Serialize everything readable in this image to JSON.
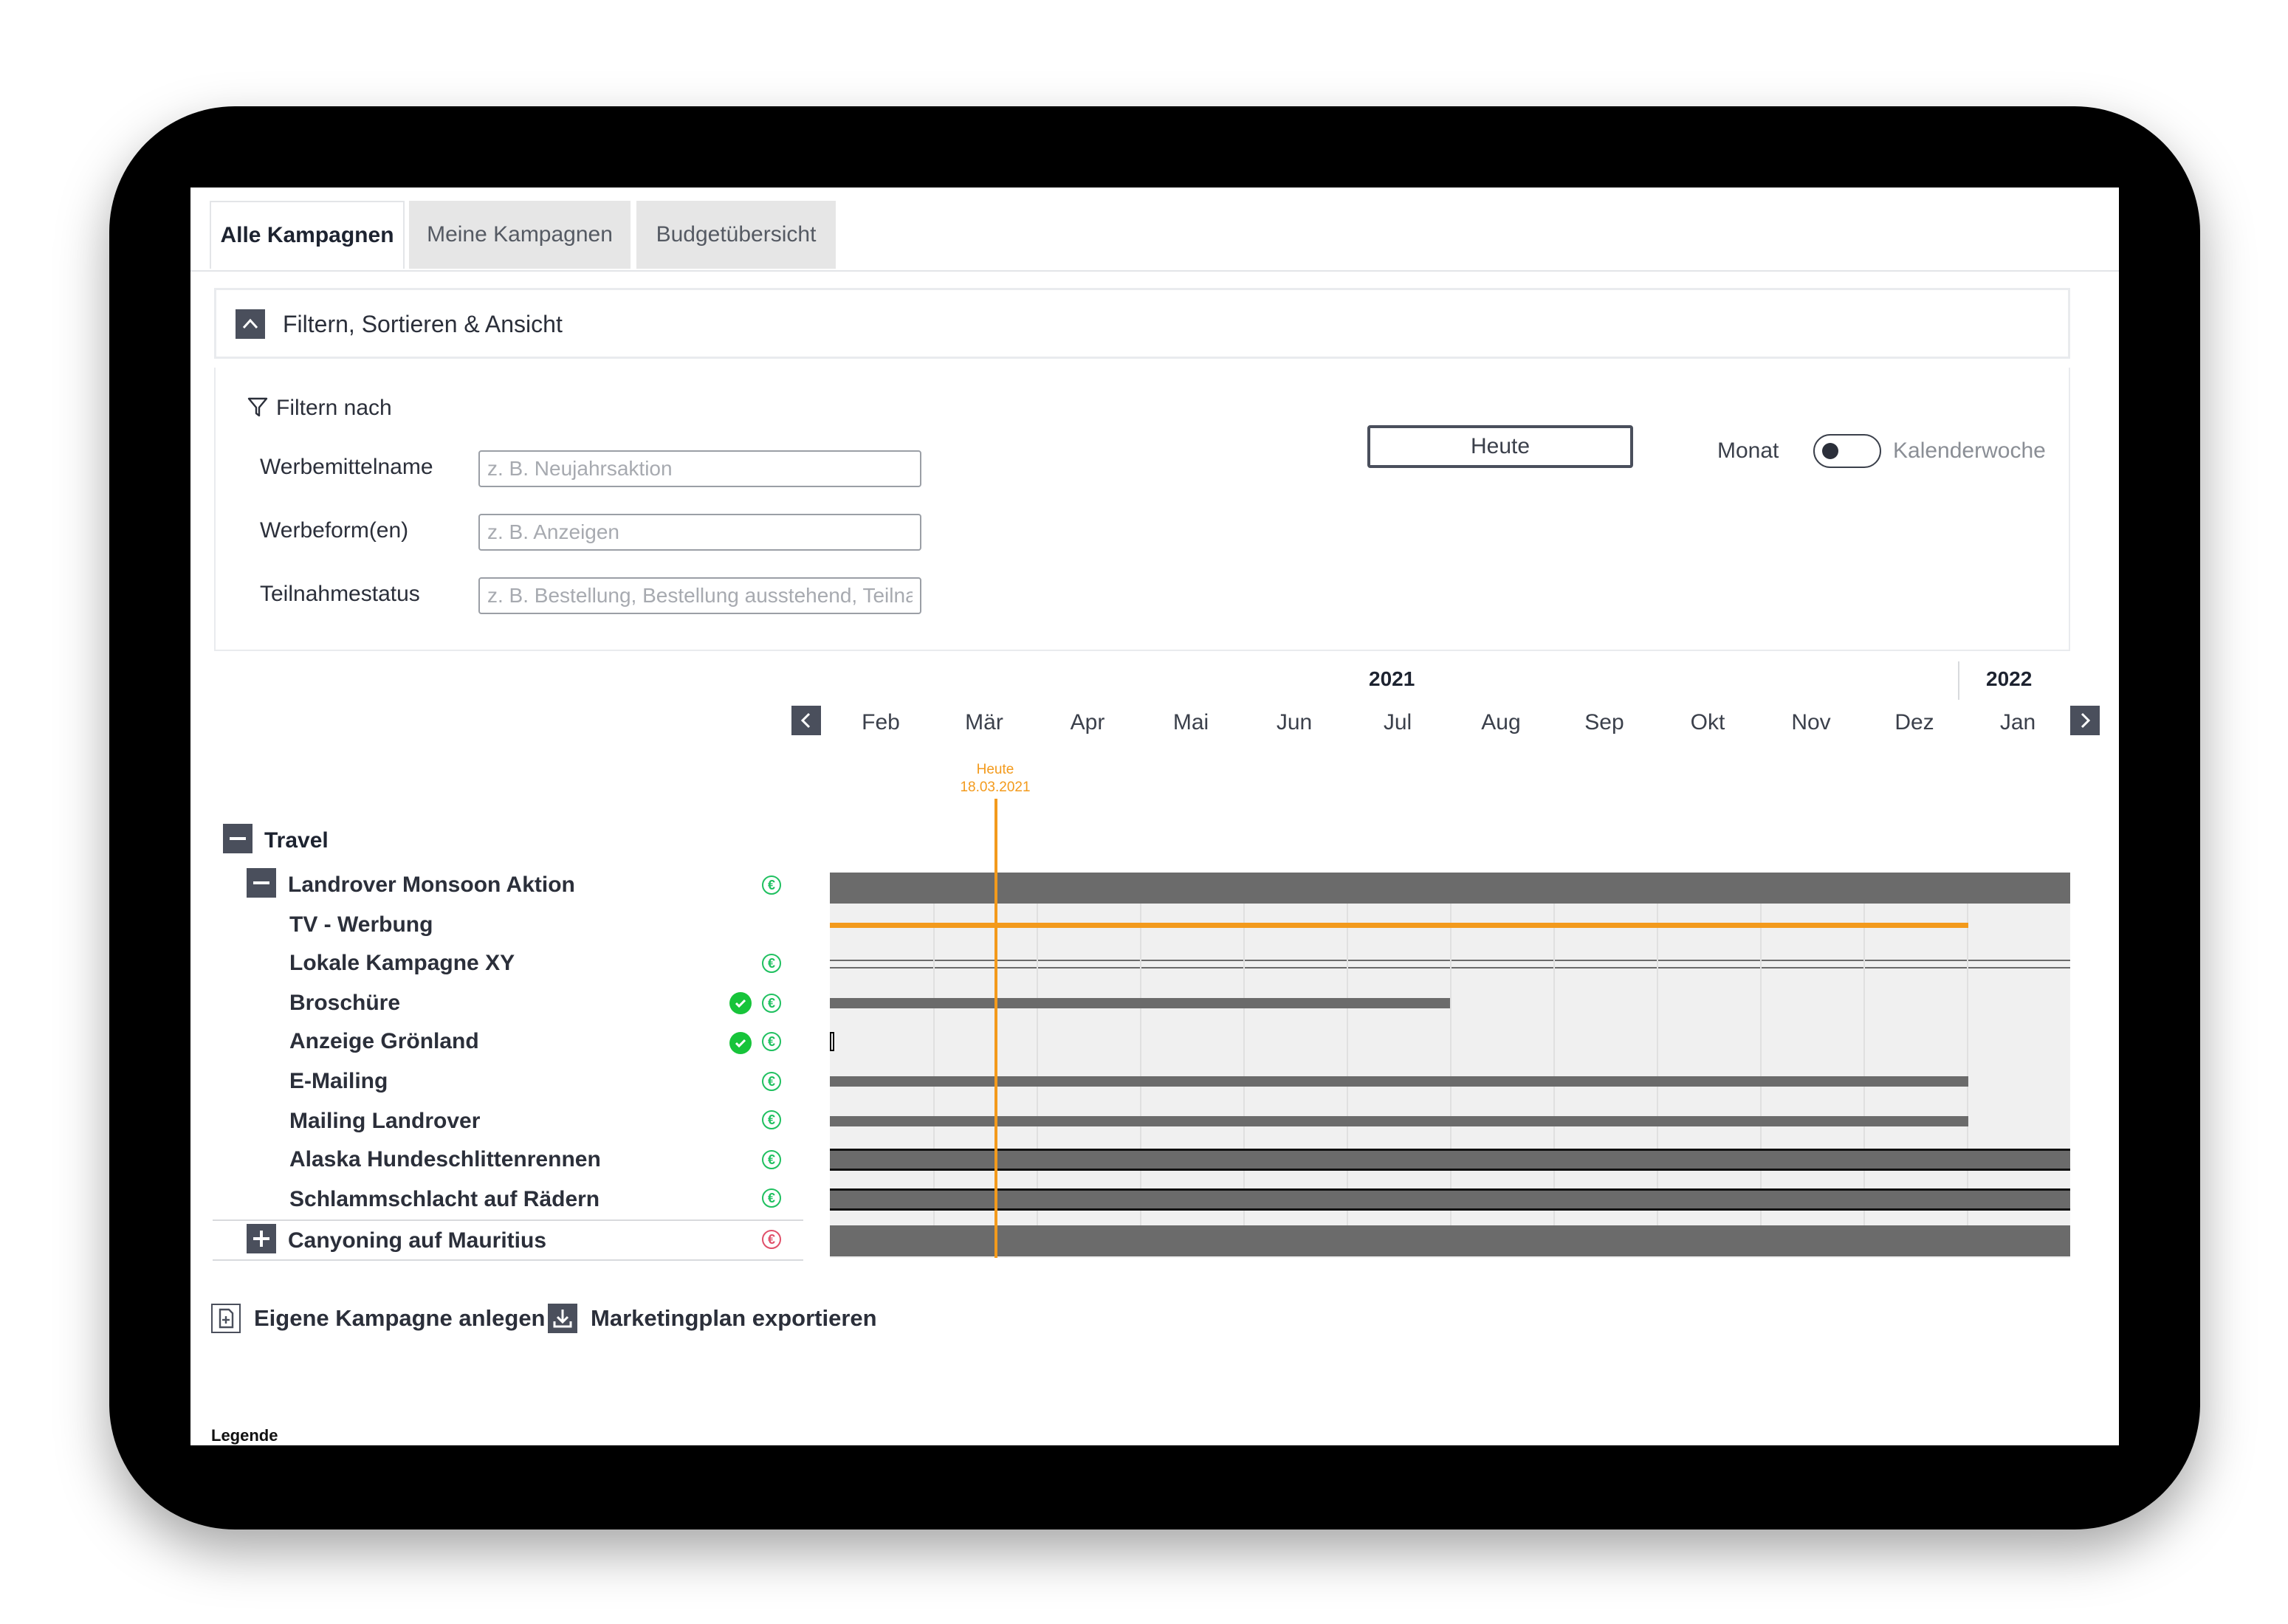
{
  "tabs": [
    {
      "label": "Alle Kampagnen",
      "active": true
    },
    {
      "label": "Meine Kampagnen",
      "active": false
    },
    {
      "label": "Budgetübersicht",
      "active": false
    }
  ],
  "filter_panel": {
    "title": "Filtern, Sortieren & Ansicht",
    "filter_heading": "Filtern nach",
    "fields": [
      {
        "label": "Werbemittelname",
        "placeholder": "z. B. Neujahrsaktion"
      },
      {
        "label": "Werbeform(en)",
        "placeholder": "z. B. Anzeigen"
      },
      {
        "label": "Teilnahmestatus",
        "placeholder": "z. B. Bestellung, Bestellung ausstehend, Teilnahme"
      }
    ],
    "today_button": "Heute",
    "view_toggle": {
      "left_label": "Monat",
      "right_label": "Kalenderwoche",
      "selected": "Monat"
    }
  },
  "timeline": {
    "years": [
      "2021",
      "2022"
    ],
    "months": [
      "Feb",
      "Mär",
      "Apr",
      "Mai",
      "Jun",
      "Jul",
      "Aug",
      "Sep",
      "Okt",
      "Nov",
      "Dez",
      "Jan"
    ],
    "today_label": "Heute",
    "today_date": "18.03.2021"
  },
  "groups": {
    "travel": {
      "label": "Travel"
    },
    "landrover": {
      "label": "Landrover Monsoon Aktion"
    },
    "items": [
      {
        "label": "TV - Werbung"
      },
      {
        "label": "Lokale Kampagne XY"
      },
      {
        "label": "Broschüre"
      },
      {
        "label": "Anzeige Grönland"
      },
      {
        "label": "E-Mailing"
      },
      {
        "label": "Mailing Landrover"
      },
      {
        "label": "Alaska Hundeschlittenrennen"
      },
      {
        "label": "Schlammschlacht auf Rädern"
      }
    ],
    "canyoning": {
      "label": "Canyoning auf Mauritius"
    }
  },
  "actions": {
    "create": "Eigene Kampagne anlegen",
    "export": "Marketingplan exportieren"
  },
  "legend": "Legende",
  "colors": {
    "accent": "#f39a1c",
    "bar": "#6b6b6b",
    "button": "#4a4f5c",
    "ok_green": "#17c43a",
    "budget_red": "#e0506a"
  },
  "euro_symbol": "€"
}
